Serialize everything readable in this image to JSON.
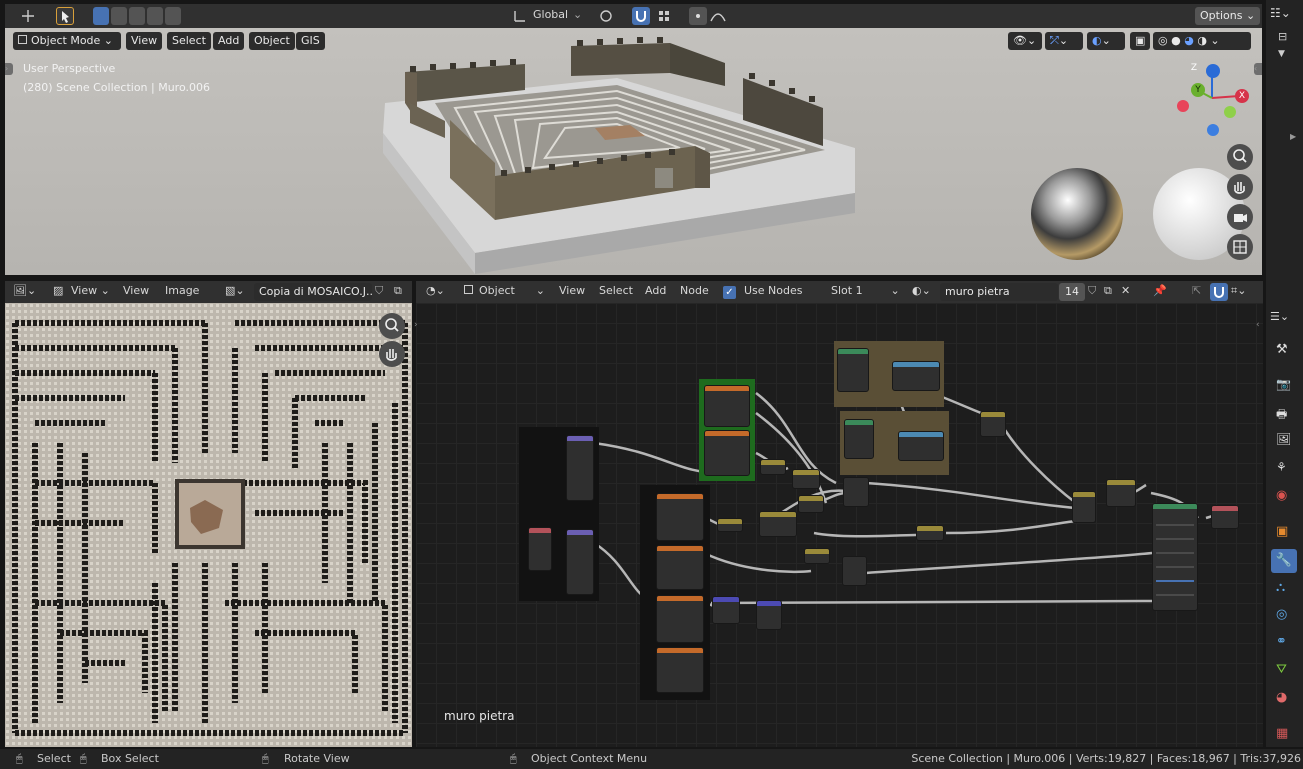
{
  "top_header": {
    "orientation_label": "Global",
    "options_label": "Options"
  },
  "viewport_header": {
    "mode_label": "Object Mode",
    "menus": [
      "View",
      "Select",
      "Add",
      "Object",
      "GIS"
    ]
  },
  "viewport": {
    "perspective_label": "User Perspective",
    "collection_label": "(280) Scene Collection | Muro.006",
    "gizmo": {
      "z": "Z",
      "y": "Y",
      "x": "X"
    }
  },
  "image_editor": {
    "menus": [
      "View",
      "View",
      "Image"
    ],
    "image_name": "Copia di MOSAICO.J..."
  },
  "node_editor": {
    "object_label": "Object",
    "menus": [
      "View",
      "Select",
      "Add",
      "Node"
    ],
    "use_nodes_label": "Use Nodes",
    "slot_label": "Slot 1",
    "material_name": "muro pietra",
    "user_count": "14",
    "canvas_label": "muro pietra"
  },
  "statusbar": {
    "select_label": "Select",
    "box_select_label": "Box Select",
    "rotate_label": "Rotate View",
    "context_menu_label": "Object Context Menu",
    "stats": "Scene Collection | Muro.006 | Verts:19,827 | Faces:18,967 | Tris:37,926"
  },
  "colors": {
    "accent": "#4772b3",
    "header_bg": "#303030",
    "panel_bg": "#232323",
    "button_bg": "#545454",
    "node_frame_brown": "#5a4f36",
    "node_frame_green": "#1e6b1e"
  }
}
